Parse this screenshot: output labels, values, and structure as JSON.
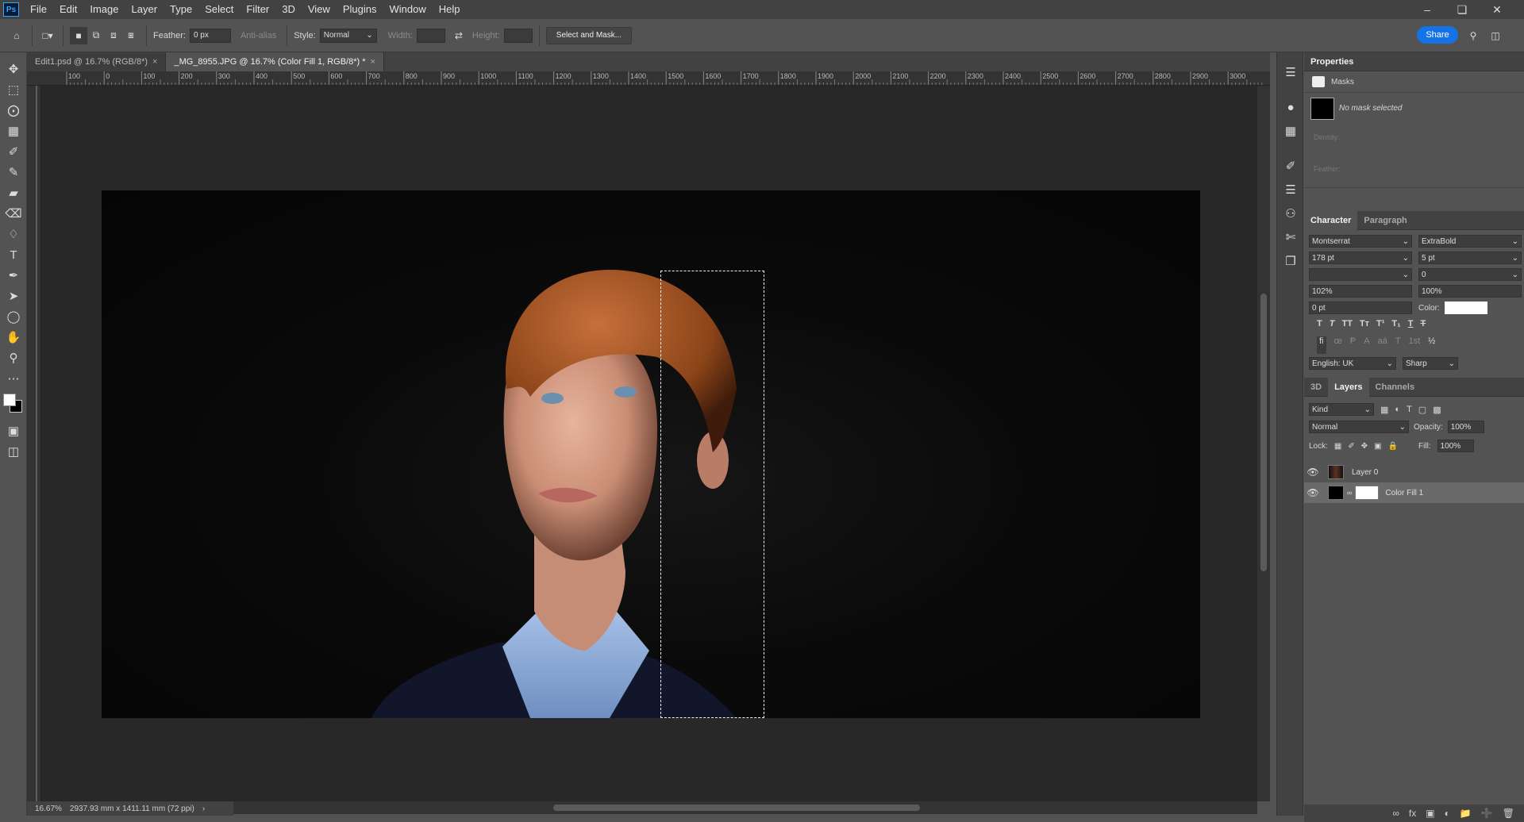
{
  "menu": {
    "logo": "Ps",
    "items": [
      "File",
      "Edit",
      "Image",
      "Layer",
      "Type",
      "Select",
      "Filter",
      "3D",
      "View",
      "Plugins",
      "Window",
      "Help"
    ]
  },
  "options": {
    "feather_label": "Feather:",
    "feather_value": "0 px",
    "anti_alias": "Anti-alias",
    "style_label": "Style:",
    "style_value": "Normal",
    "width_label": "Width:",
    "height_label": "Height:",
    "select_mask": "Select and Mask...",
    "share": "Share"
  },
  "tabs": [
    {
      "label": "Edit1.psd @ 16.7% (RGB/8*)"
    },
    {
      "label": "_MG_8955.JPG @ 16.7% (Color Fill 1, RGB/8*) *"
    }
  ],
  "ruler_top": [
    "100",
    "0",
    "100",
    "200",
    "300",
    "400",
    "500",
    "600",
    "700",
    "800",
    "900",
    "1000",
    "1100",
    "1200",
    "1300",
    "1400",
    "1500",
    "1600",
    "1700",
    "1800",
    "1900",
    "2000",
    "2100",
    "2200",
    "2300",
    "2400",
    "2500",
    "2600",
    "2700",
    "2800",
    "2900",
    "3000"
  ],
  "status": {
    "zoom": "16.67%",
    "size": "2937.93 mm x 1411.11 mm (72 ppi)"
  },
  "properties": {
    "title": "Properties",
    "section": "Masks",
    "no_mask": "No mask selected",
    "density": "Density:",
    "feather": "Feather:"
  },
  "character": {
    "tabs": [
      "Character",
      "Paragraph"
    ],
    "font": "Montserrat",
    "weight": "ExtraBold",
    "size": "178 pt",
    "leading": "5 pt",
    "kerning": "",
    "tracking": "0",
    "vscale": "102%",
    "hscale": "100%",
    "baseline": "0 pt",
    "color_label": "Color:",
    "language": "English: UK",
    "aa": "Sharp"
  },
  "layers": {
    "tabs": [
      "3D",
      "Layers",
      "Channels"
    ],
    "filter": "Kind",
    "blend": "Normal",
    "opacity_label": "Opacity:",
    "opacity": "100%",
    "lock_label": "Lock:",
    "fill_label": "Fill:",
    "fill": "100%",
    "items": [
      {
        "name": "Layer 0"
      },
      {
        "name": "Color Fill 1"
      }
    ]
  },
  "colors": {
    "accent": "#1473e6",
    "bg": "#535353",
    "canvas": "#282828"
  }
}
